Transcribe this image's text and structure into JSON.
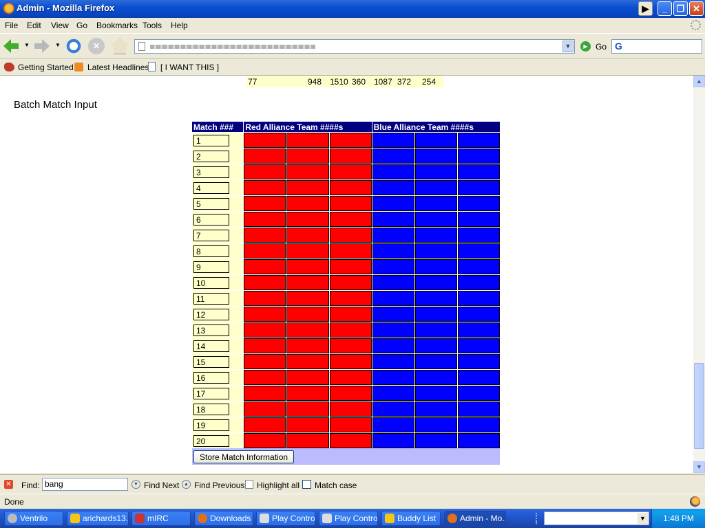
{
  "window": {
    "title": "Admin - Mozilla Firefox"
  },
  "menubar": [
    "File",
    "Edit",
    "View",
    "Go",
    "Bookmarks",
    "Tools",
    "Help"
  ],
  "navbar": {
    "go_label": "Go"
  },
  "bookmarks": [
    "Getting Started",
    "Latest Headlines",
    "[ I WANT THIS ]"
  ],
  "summary_row": [
    "77",
    "948",
    "1510",
    "360",
    "1087",
    "372",
    "254"
  ],
  "page": {
    "heading": "Batch Match Input",
    "headers": {
      "match": "Match ###",
      "red": "Red Alliance Team ####s",
      "blue": "Blue Alliance Team ####s"
    },
    "matches": [
      "1",
      "2",
      "3",
      "4",
      "5",
      "6",
      "7",
      "8",
      "9",
      "10",
      "11",
      "12",
      "13",
      "14",
      "15",
      "16",
      "17",
      "18",
      "19",
      "20"
    ],
    "colors": {
      "red": "#ff0000",
      "blue": "#0000ff",
      "header": "#000080",
      "cell": "#ffffcc"
    },
    "store_button": "Store Match Information"
  },
  "findbar": {
    "label": "Find:",
    "value": "bang",
    "find_next": "Find Next",
    "find_previous": "Find Previous",
    "highlight_all": "Highlight all",
    "match_case": "Match case"
  },
  "status": "Done",
  "taskbar": {
    "items": [
      "Ventrilo",
      "arichards13...",
      "mIRC",
      "Downloads",
      "Play Control",
      "Play Control",
      "Buddy List",
      "Admin - Mo..."
    ],
    "clock": "1:48 PM"
  }
}
